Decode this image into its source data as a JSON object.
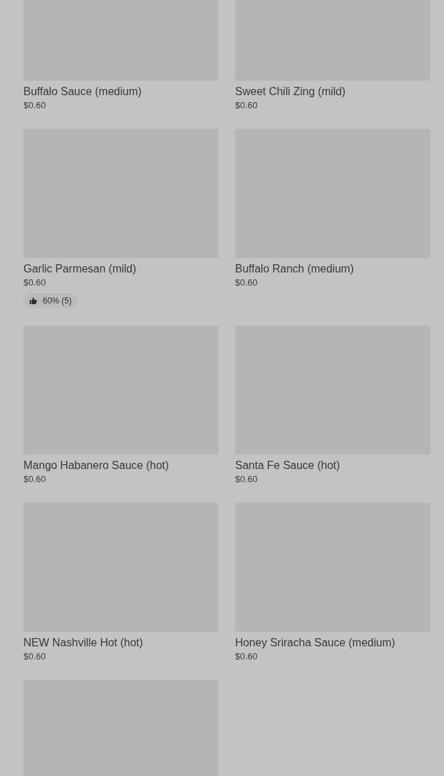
{
  "products": [
    {
      "kind": "product",
      "name": "Buffalo Sauce (medium)",
      "price": "$0.60"
    },
    {
      "kind": "product",
      "name": "Sweet Chili Zing (mild)",
      "price": "$0.60"
    },
    {
      "kind": "product",
      "name": "Garlic Parmesan (mild)",
      "price": "$0.60",
      "rating": "60% (5)"
    },
    {
      "kind": "product",
      "name": "Buffalo Ranch (medium)",
      "price": "$0.60"
    },
    {
      "kind": "product",
      "name": "Mango Habanero Sauce (hot)",
      "price": "$0.60"
    },
    {
      "kind": "product",
      "name": "Santa Fe Sauce (hot)",
      "price": "$0.60"
    },
    {
      "kind": "product",
      "name": "NEW Nashville Hot (hot)",
      "price": "$0.60"
    },
    {
      "kind": "product",
      "name": "Honey Sriracha Sauce (medium)",
      "price": "$0.60"
    },
    {
      "kind": "image_only"
    }
  ]
}
